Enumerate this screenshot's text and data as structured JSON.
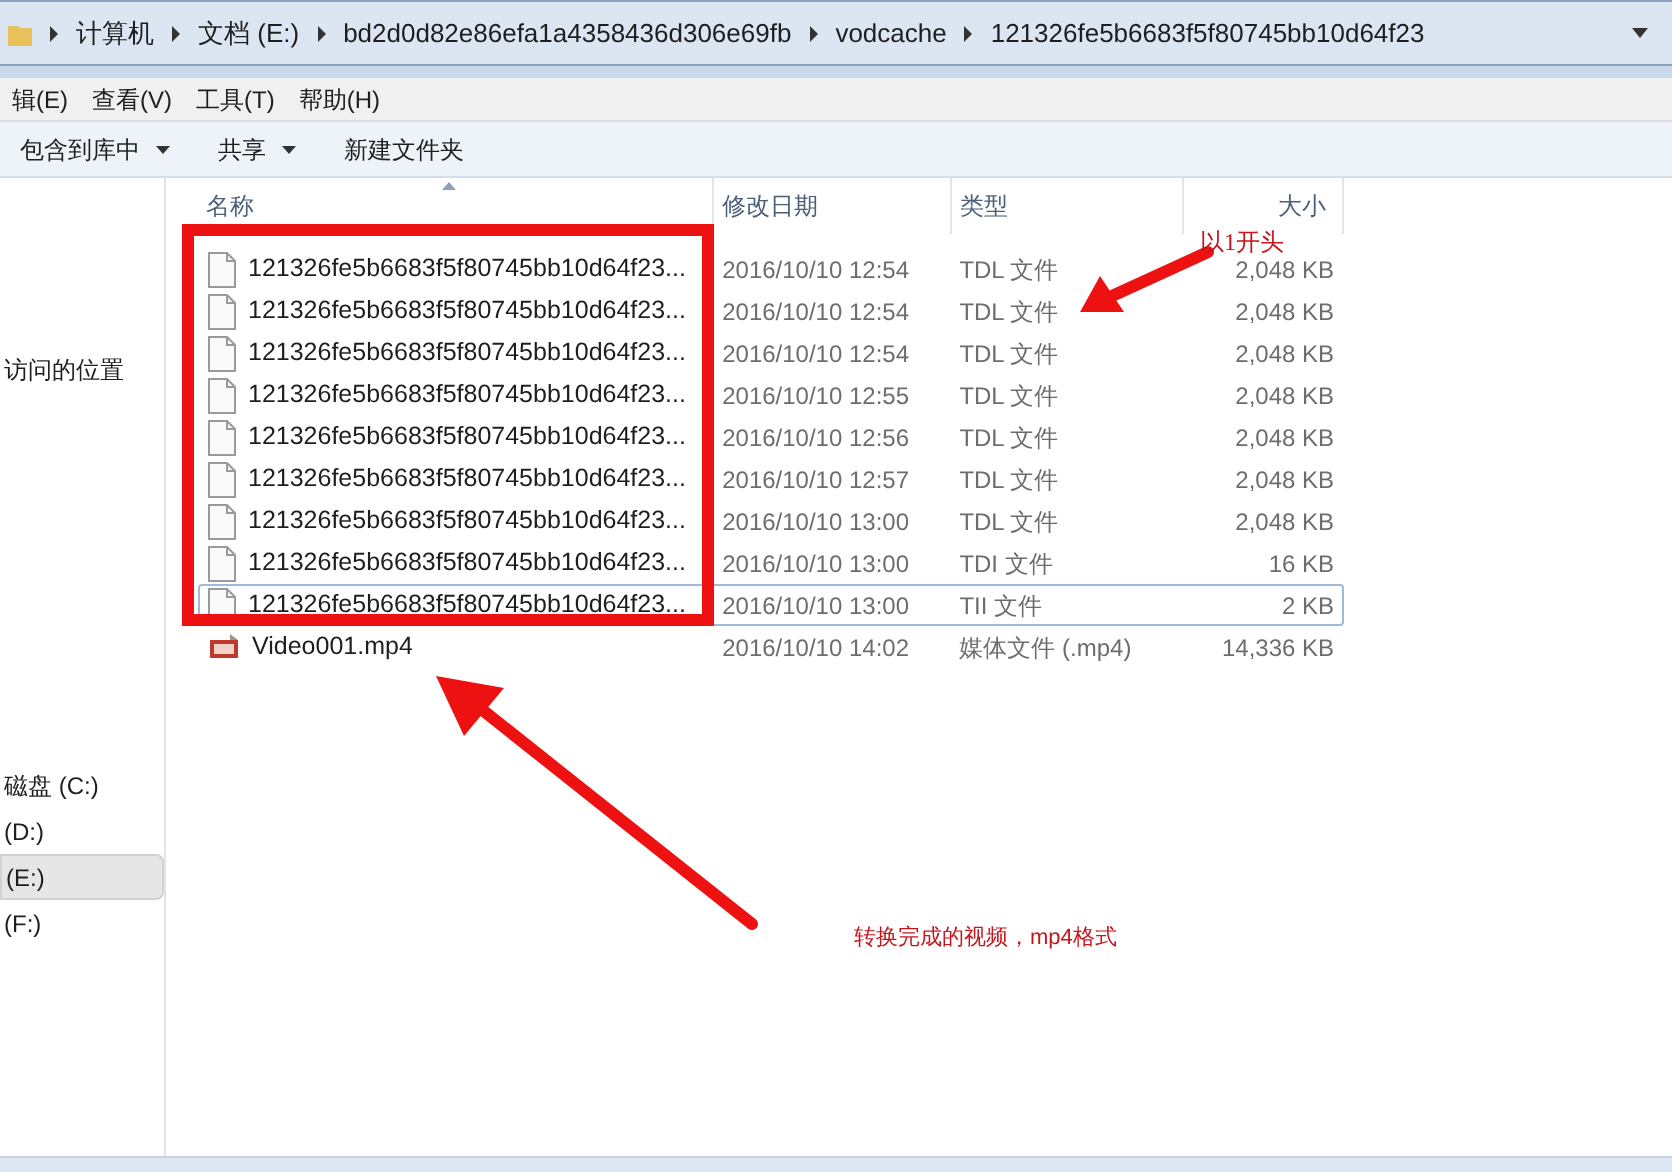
{
  "address_bar": {
    "crumbs": [
      "计算机",
      "文档 (E:)",
      "bd2d0d82e86efa1a4358436d306e69fb",
      "vodcache",
      "121326fe5b6683f5f80745bb10d64f23"
    ]
  },
  "menu_bar": [
    "辑(E)",
    "查看(V)",
    "工具(T)",
    "帮助(H)"
  ],
  "toolbar": [
    {
      "label": "包含到库中",
      "dropdown": true
    },
    {
      "label": "共享",
      "dropdown": true
    },
    {
      "label": "新建文件夹",
      "dropdown": false
    }
  ],
  "sidebar": {
    "items": [
      {
        "label": "访问的位置",
        "selected": false
      },
      {
        "label": "磁盘 (C:)",
        "selected": false
      },
      {
        "label": "(D:)",
        "selected": false
      },
      {
        "label": "(E:)",
        "selected": true
      },
      {
        "label": "(F:)",
        "selected": false
      }
    ]
  },
  "table": {
    "columns": [
      "名称",
      "修改日期",
      "类型",
      "大小"
    ],
    "rows": [
      {
        "kind": "file",
        "name": "121326fe5b6683f5f80745bb10d64f23...",
        "date": "2016/10/10 12:54",
        "type": "TDL 文件",
        "size": "2,048 KB",
        "selected": false
      },
      {
        "kind": "file",
        "name": "121326fe5b6683f5f80745bb10d64f23...",
        "date": "2016/10/10 12:54",
        "type": "TDL 文件",
        "size": "2,048 KB",
        "selected": false
      },
      {
        "kind": "file",
        "name": "121326fe5b6683f5f80745bb10d64f23...",
        "date": "2016/10/10 12:54",
        "type": "TDL 文件",
        "size": "2,048 KB",
        "selected": false
      },
      {
        "kind": "file",
        "name": "121326fe5b6683f5f80745bb10d64f23...",
        "date": "2016/10/10 12:55",
        "type": "TDL 文件",
        "size": "2,048 KB",
        "selected": false
      },
      {
        "kind": "file",
        "name": "121326fe5b6683f5f80745bb10d64f23...",
        "date": "2016/10/10 12:56",
        "type": "TDL 文件",
        "size": "2,048 KB",
        "selected": false
      },
      {
        "kind": "file",
        "name": "121326fe5b6683f5f80745bb10d64f23...",
        "date": "2016/10/10 12:57",
        "type": "TDL 文件",
        "size": "2,048 KB",
        "selected": false
      },
      {
        "kind": "file",
        "name": "121326fe5b6683f5f80745bb10d64f23...",
        "date": "2016/10/10 13:00",
        "type": "TDL 文件",
        "size": "2,048 KB",
        "selected": false
      },
      {
        "kind": "file",
        "name": "121326fe5b6683f5f80745bb10d64f23...",
        "date": "2016/10/10 13:00",
        "type": "TDI 文件",
        "size": "16 KB",
        "selected": false
      },
      {
        "kind": "file",
        "name": "121326fe5b6683f5f80745bb10d64f23...",
        "date": "2016/10/10 13:00",
        "type": "TII 文件",
        "size": "2 KB",
        "selected": true
      },
      {
        "kind": "video",
        "name": "Video001.mp4",
        "date": "2016/10/10 14:02",
        "type": "媒体文件 (.mp4)",
        "size": "14,336 KB",
        "selected": false
      }
    ]
  },
  "annotations": [
    "以1开头",
    "转换完成的视频，mp4格式"
  ]
}
